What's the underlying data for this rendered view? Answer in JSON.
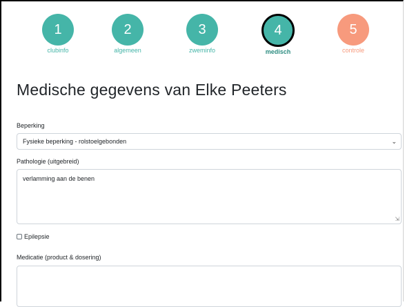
{
  "stepper": {
    "steps": [
      {
        "number": "1",
        "label": "clubinfo"
      },
      {
        "number": "2",
        "label": "algemeen"
      },
      {
        "number": "3",
        "label": "zweminfo"
      },
      {
        "number": "4",
        "label": "medisch"
      },
      {
        "number": "5",
        "label": "controle"
      }
    ],
    "active_index": 4
  },
  "page": {
    "title": "Medische gegevens van Elke Peeters"
  },
  "form": {
    "beperking": {
      "label": "Beperking",
      "value": "Fysieke beperking - rolstoelgebonden"
    },
    "pathologie": {
      "label": "Pathologie (uitgebreid)",
      "value": "verlamming aan de benen"
    },
    "epilepsie": {
      "label": "Epilepsie",
      "checked": false
    },
    "medicatie": {
      "label": "Medicatie (product & dosering)",
      "value": ""
    }
  },
  "colors": {
    "teal": "#45b5a8",
    "salmon": "#f79a7d",
    "active_border": "#000000"
  }
}
